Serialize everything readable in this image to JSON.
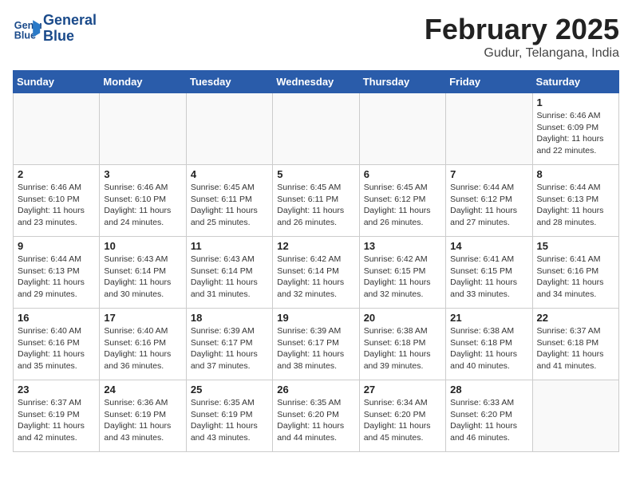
{
  "header": {
    "logo_line1": "General",
    "logo_line2": "Blue",
    "month": "February 2025",
    "location": "Gudur, Telangana, India"
  },
  "weekdays": [
    "Sunday",
    "Monday",
    "Tuesday",
    "Wednesday",
    "Thursday",
    "Friday",
    "Saturday"
  ],
  "weeks": [
    [
      {
        "day": "",
        "info": ""
      },
      {
        "day": "",
        "info": ""
      },
      {
        "day": "",
        "info": ""
      },
      {
        "day": "",
        "info": ""
      },
      {
        "day": "",
        "info": ""
      },
      {
        "day": "",
        "info": ""
      },
      {
        "day": "1",
        "info": "Sunrise: 6:46 AM\nSunset: 6:09 PM\nDaylight: 11 hours\nand 22 minutes."
      }
    ],
    [
      {
        "day": "2",
        "info": "Sunrise: 6:46 AM\nSunset: 6:10 PM\nDaylight: 11 hours\nand 23 minutes."
      },
      {
        "day": "3",
        "info": "Sunrise: 6:46 AM\nSunset: 6:10 PM\nDaylight: 11 hours\nand 24 minutes."
      },
      {
        "day": "4",
        "info": "Sunrise: 6:45 AM\nSunset: 6:11 PM\nDaylight: 11 hours\nand 25 minutes."
      },
      {
        "day": "5",
        "info": "Sunrise: 6:45 AM\nSunset: 6:11 PM\nDaylight: 11 hours\nand 26 minutes."
      },
      {
        "day": "6",
        "info": "Sunrise: 6:45 AM\nSunset: 6:12 PM\nDaylight: 11 hours\nand 26 minutes."
      },
      {
        "day": "7",
        "info": "Sunrise: 6:44 AM\nSunset: 6:12 PM\nDaylight: 11 hours\nand 27 minutes."
      },
      {
        "day": "8",
        "info": "Sunrise: 6:44 AM\nSunset: 6:13 PM\nDaylight: 11 hours\nand 28 minutes."
      }
    ],
    [
      {
        "day": "9",
        "info": "Sunrise: 6:44 AM\nSunset: 6:13 PM\nDaylight: 11 hours\nand 29 minutes."
      },
      {
        "day": "10",
        "info": "Sunrise: 6:43 AM\nSunset: 6:14 PM\nDaylight: 11 hours\nand 30 minutes."
      },
      {
        "day": "11",
        "info": "Sunrise: 6:43 AM\nSunset: 6:14 PM\nDaylight: 11 hours\nand 31 minutes."
      },
      {
        "day": "12",
        "info": "Sunrise: 6:42 AM\nSunset: 6:14 PM\nDaylight: 11 hours\nand 32 minutes."
      },
      {
        "day": "13",
        "info": "Sunrise: 6:42 AM\nSunset: 6:15 PM\nDaylight: 11 hours\nand 32 minutes."
      },
      {
        "day": "14",
        "info": "Sunrise: 6:41 AM\nSunset: 6:15 PM\nDaylight: 11 hours\nand 33 minutes."
      },
      {
        "day": "15",
        "info": "Sunrise: 6:41 AM\nSunset: 6:16 PM\nDaylight: 11 hours\nand 34 minutes."
      }
    ],
    [
      {
        "day": "16",
        "info": "Sunrise: 6:40 AM\nSunset: 6:16 PM\nDaylight: 11 hours\nand 35 minutes."
      },
      {
        "day": "17",
        "info": "Sunrise: 6:40 AM\nSunset: 6:16 PM\nDaylight: 11 hours\nand 36 minutes."
      },
      {
        "day": "18",
        "info": "Sunrise: 6:39 AM\nSunset: 6:17 PM\nDaylight: 11 hours\nand 37 minutes."
      },
      {
        "day": "19",
        "info": "Sunrise: 6:39 AM\nSunset: 6:17 PM\nDaylight: 11 hours\nand 38 minutes."
      },
      {
        "day": "20",
        "info": "Sunrise: 6:38 AM\nSunset: 6:18 PM\nDaylight: 11 hours\nand 39 minutes."
      },
      {
        "day": "21",
        "info": "Sunrise: 6:38 AM\nSunset: 6:18 PM\nDaylight: 11 hours\nand 40 minutes."
      },
      {
        "day": "22",
        "info": "Sunrise: 6:37 AM\nSunset: 6:18 PM\nDaylight: 11 hours\nand 41 minutes."
      }
    ],
    [
      {
        "day": "23",
        "info": "Sunrise: 6:37 AM\nSunset: 6:19 PM\nDaylight: 11 hours\nand 42 minutes."
      },
      {
        "day": "24",
        "info": "Sunrise: 6:36 AM\nSunset: 6:19 PM\nDaylight: 11 hours\nand 43 minutes."
      },
      {
        "day": "25",
        "info": "Sunrise: 6:35 AM\nSunset: 6:19 PM\nDaylight: 11 hours\nand 43 minutes."
      },
      {
        "day": "26",
        "info": "Sunrise: 6:35 AM\nSunset: 6:20 PM\nDaylight: 11 hours\nand 44 minutes."
      },
      {
        "day": "27",
        "info": "Sunrise: 6:34 AM\nSunset: 6:20 PM\nDaylight: 11 hours\nand 45 minutes."
      },
      {
        "day": "28",
        "info": "Sunrise: 6:33 AM\nSunset: 6:20 PM\nDaylight: 11 hours\nand 46 minutes."
      },
      {
        "day": "",
        "info": ""
      }
    ]
  ]
}
